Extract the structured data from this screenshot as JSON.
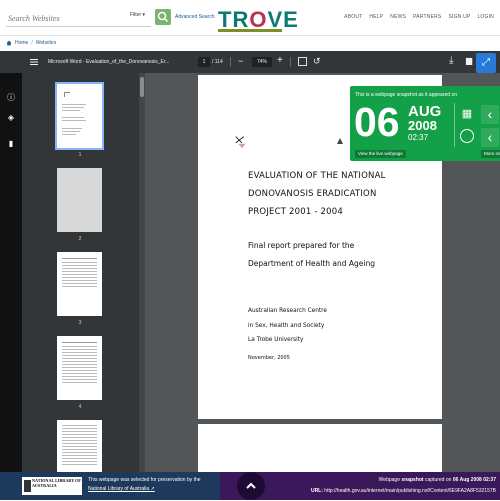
{
  "header": {
    "search_placeholder": "Search Websites",
    "filter_label": "Filter ▾",
    "advanced_search": "Advanced Search",
    "logo": "TROVE",
    "nav": [
      "ABOUT",
      "HELP",
      "NEWS",
      "PARTNERS",
      "SIGN UP",
      "LOGIN"
    ]
  },
  "breadcrumb": {
    "home": "Home",
    "separator": "/",
    "current": "Websites"
  },
  "viewer": {
    "title": "Microsoft Word - Evaluation_of_the_Donovanosis_Er...",
    "current_page": "1",
    "page_count": "/ 114",
    "zoom": "74%",
    "thumbnails": [
      {
        "num": "1",
        "selected": true
      },
      {
        "num": "2",
        "selected": false
      },
      {
        "num": "3",
        "selected": false
      },
      {
        "num": "4",
        "selected": false
      }
    ]
  },
  "document": {
    "title_lines": [
      "EVALUATION OF THE NATIONAL",
      "DONOVANOSIS ERADICATION",
      "PROJECT 2001 - 2004"
    ],
    "subtitle_lines": [
      "Final report prepared for the",
      "Department of Health and Ageing"
    ],
    "org_lines": [
      "Australian Research Centre",
      "in Sex, Health and Society",
      "La Trobe University"
    ],
    "date": "November, 2005"
  },
  "snapshot": {
    "caption": "This is a webpage snapshot as it appeared on",
    "day": "06",
    "month": "AUG",
    "year": "2008",
    "time": "02:37",
    "live_link": "View the live webpage",
    "more": "More sn"
  },
  "footer": {
    "nla_logo": "NATIONAL LIBRARY OF AUSTRALIA",
    "selected_text": "This webpage was selected for preservation by the",
    "nla_link": "National Library of Australia",
    "capture_prefix": "Webpage",
    "capture_bold": "snapshot",
    "capture_mid": "captured on",
    "capture_date": "06 Aug 2008 02:37",
    "url_label": "URL:",
    "url": "http://health.gov.au/internet/main/publishing.nsf/Content/6E9FA2A8F532157B"
  },
  "colors": {
    "trove_teal": "#0c7a73",
    "trove_pink": "#bf2e54",
    "snapshot_green": "#14a048",
    "footer_navy": "#1d3a5c",
    "footer_purple": "#3a1859",
    "viewer_toolbar": "#323639"
  }
}
